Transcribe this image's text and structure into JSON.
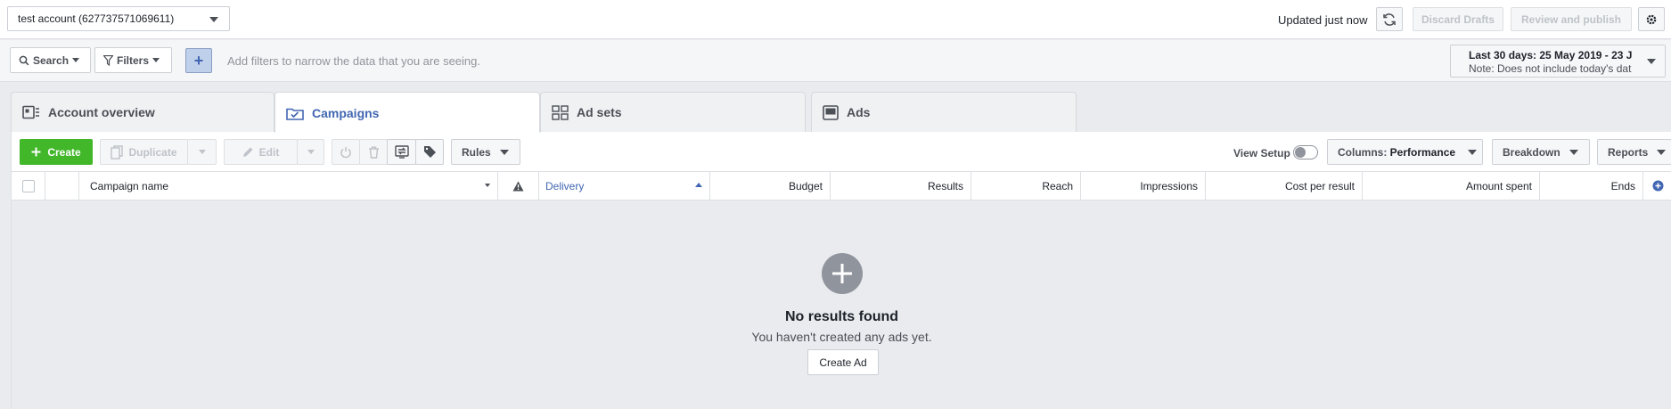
{
  "topbar": {
    "account_label": "test account (627737571069611)",
    "updated_text": "Updated just now",
    "discard_label": "Discard Drafts",
    "review_label": "Review and publish"
  },
  "filterbar": {
    "search_label": "Search",
    "filters_label": "Filters",
    "hint": "Add filters to narrow the data that you are seeing.",
    "date_line1": "Last 30 days: 25 May 2019 - 23 J",
    "date_line2": "Note: Does not include today's dat"
  },
  "tabs": [
    {
      "label": "Account overview",
      "icon": "account-overview-icon"
    },
    {
      "label": "Campaigns",
      "icon": "campaigns-folder-icon"
    },
    {
      "label": "Ad sets",
      "icon": "ad-sets-grid-icon"
    },
    {
      "label": "Ads",
      "icon": "ads-icon"
    }
  ],
  "toolbar": {
    "create_label": "Create",
    "duplicate_label": "Duplicate",
    "edit_label": "Edit",
    "rules_label": "Rules",
    "view_setup_label": "View Setup",
    "columns_prefix": "Columns: ",
    "columns_value": "Performance",
    "breakdown_label": "Breakdown",
    "reports_label": "Reports"
  },
  "table": {
    "columns": [
      "Campaign name",
      "Delivery",
      "Budget",
      "Results",
      "Reach",
      "Impressions",
      "Cost per result",
      "Amount spent",
      "Ends"
    ]
  },
  "empty_state": {
    "title": "No results found",
    "subtitle": "You haven't created any ads yet.",
    "button_label": "Create Ad"
  },
  "colors": {
    "accent": "#4267b2",
    "create_green": "#42b72a",
    "background": "#e9ebee"
  }
}
